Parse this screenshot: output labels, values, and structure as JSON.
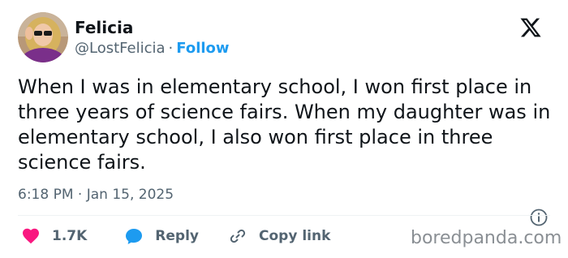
{
  "author": {
    "name": "Felicia",
    "handle": "@LostFelicia",
    "separator": "·",
    "follow_label": "Follow"
  },
  "tweet": {
    "text": "When I was in elementary school, I won first place in three years of science fairs. When my daughter was in elementary school, I also won first place in three science fairs.",
    "timestamp": "6:18 PM · Jan 15, 2025"
  },
  "actions": {
    "likes_count": "1.7K",
    "reply_label": "Reply",
    "copy_link_label": "Copy link"
  },
  "watermark": "boredpanda.com",
  "colors": {
    "text": "#0f1419",
    "secondary": "#536471",
    "follow": "#1d9bf0",
    "heart": "#f91880",
    "reply_bubble": "#1d9bf0"
  },
  "icons": {
    "brand": "x-logo-icon",
    "info": "info-icon",
    "like": "heart-icon",
    "reply": "speech-bubble-icon",
    "copy": "link-icon"
  }
}
